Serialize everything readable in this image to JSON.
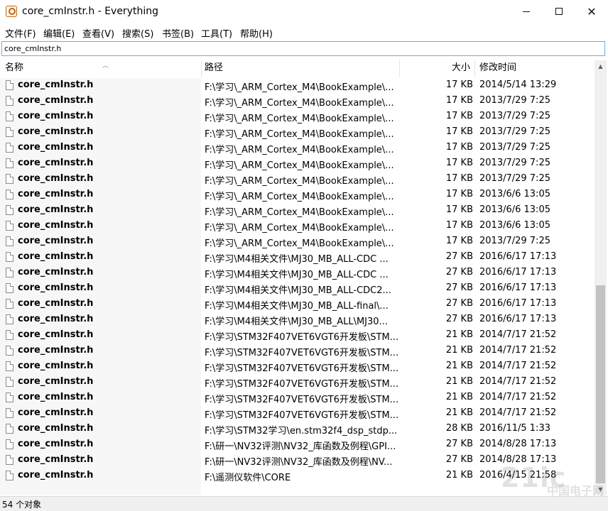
{
  "window": {
    "title": "core_cmInstr.h - Everything",
    "icon": "everything-app-icon"
  },
  "menu": [
    "文件(F)",
    "编辑(E)",
    "查看(V)",
    "搜索(S)",
    "书签(B)",
    "工具(T)",
    "帮助(H)"
  ],
  "search": {
    "value": "core_cmInstr.h"
  },
  "columns": {
    "name": "名称",
    "path": "路径",
    "size": "大小",
    "modified": "修改时间"
  },
  "rows": [
    {
      "name": "core_cmInstr.h",
      "path": "F:\\学习\\_ARM_Cortex_M4\\BookExample\\...",
      "size": "17 KB",
      "modified": "2014/5/14 13:29"
    },
    {
      "name": "core_cmInstr.h",
      "path": "F:\\学习\\_ARM_Cortex_M4\\BookExample\\...",
      "size": "17 KB",
      "modified": "2013/7/29 7:25"
    },
    {
      "name": "core_cmInstr.h",
      "path": "F:\\学习\\_ARM_Cortex_M4\\BookExample\\...",
      "size": "17 KB",
      "modified": "2013/7/29 7:25"
    },
    {
      "name": "core_cmInstr.h",
      "path": "F:\\学习\\_ARM_Cortex_M4\\BookExample\\...",
      "size": "17 KB",
      "modified": "2013/7/29 7:25"
    },
    {
      "name": "core_cmInstr.h",
      "path": "F:\\学习\\_ARM_Cortex_M4\\BookExample\\...",
      "size": "17 KB",
      "modified": "2013/7/29 7:25"
    },
    {
      "name": "core_cmInstr.h",
      "path": "F:\\学习\\_ARM_Cortex_M4\\BookExample\\...",
      "size": "17 KB",
      "modified": "2013/7/29 7:25"
    },
    {
      "name": "core_cmInstr.h",
      "path": "F:\\学习\\_ARM_Cortex_M4\\BookExample\\...",
      "size": "17 KB",
      "modified": "2013/7/29 7:25"
    },
    {
      "name": "core_cmInstr.h",
      "path": "F:\\学习\\_ARM_Cortex_M4\\BookExample\\...",
      "size": "17 KB",
      "modified": "2013/6/6 13:05"
    },
    {
      "name": "core_cmInstr.h",
      "path": "F:\\学习\\_ARM_Cortex_M4\\BookExample\\...",
      "size": "17 KB",
      "modified": "2013/6/6 13:05"
    },
    {
      "name": "core_cmInstr.h",
      "path": "F:\\学习\\_ARM_Cortex_M4\\BookExample\\...",
      "size": "17 KB",
      "modified": "2013/6/6 13:05"
    },
    {
      "name": "core_cmInstr.h",
      "path": "F:\\学习\\_ARM_Cortex_M4\\BookExample\\...",
      "size": "17 KB",
      "modified": "2013/7/29 7:25"
    },
    {
      "name": "core_cmInstr.h",
      "path": "F:\\学习\\M4相关文件\\MJ30_MB_ALL-CDC ...",
      "size": "27 KB",
      "modified": "2016/6/17 17:13"
    },
    {
      "name": "core_cmInstr.h",
      "path": "F:\\学习\\M4相关文件\\MJ30_MB_ALL-CDC ...",
      "size": "27 KB",
      "modified": "2016/6/17 17:13"
    },
    {
      "name": "core_cmInstr.h",
      "path": "F:\\学习\\M4相关文件\\MJ30_MB_ALL-CDC2...",
      "size": "27 KB",
      "modified": "2016/6/17 17:13"
    },
    {
      "name": "core_cmInstr.h",
      "path": "F:\\学习\\M4相关文件\\MJ30_MB_ALL-final\\...",
      "size": "27 KB",
      "modified": "2016/6/17 17:13"
    },
    {
      "name": "core_cmInstr.h",
      "path": "F:\\学习\\M4相关文件\\MJ30_MB_ALL\\MJ30...",
      "size": "27 KB",
      "modified": "2016/6/17 17:13"
    },
    {
      "name": "core_cmInstr.h",
      "path": "F:\\学习\\STM32F407VET6VGT6开发板\\STM...",
      "size": "21 KB",
      "modified": "2014/7/17 21:52"
    },
    {
      "name": "core_cmInstr.h",
      "path": "F:\\学习\\STM32F407VET6VGT6开发板\\STM...",
      "size": "21 KB",
      "modified": "2014/7/17 21:52"
    },
    {
      "name": "core_cmInstr.h",
      "path": "F:\\学习\\STM32F407VET6VGT6开发板\\STM...",
      "size": "21 KB",
      "modified": "2014/7/17 21:52"
    },
    {
      "name": "core_cmInstr.h",
      "path": "F:\\学习\\STM32F407VET6VGT6开发板\\STM...",
      "size": "21 KB",
      "modified": "2014/7/17 21:52"
    },
    {
      "name": "core_cmInstr.h",
      "path": "F:\\学习\\STM32F407VET6VGT6开发板\\STM...",
      "size": "21 KB",
      "modified": "2014/7/17 21:52"
    },
    {
      "name": "core_cmInstr.h",
      "path": "F:\\学习\\STM32F407VET6VGT6开发板\\STM...",
      "size": "21 KB",
      "modified": "2014/7/17 21:52"
    },
    {
      "name": "core_cmInstr.h",
      "path": "F:\\学习\\STM32学习\\en.stm32f4_dsp_stdp...",
      "size": "28 KB",
      "modified": "2016/11/5 1:33"
    },
    {
      "name": "core_cmInstr.h",
      "path": "F:\\研一\\NV32评测\\NV32_库函数及例程\\GPI...",
      "size": "27 KB",
      "modified": "2014/8/28 17:13"
    },
    {
      "name": "core_cmInstr.h",
      "path": "F:\\研一\\NV32评测\\NV32_库函数及例程\\NV...",
      "size": "27 KB",
      "modified": "2014/8/28 17:13"
    },
    {
      "name": "core_cmInstr.h",
      "path": "F:\\遥测仪软件\\CORE",
      "size": "21 KB",
      "modified": "2016/4/15 21:58"
    }
  ],
  "status": {
    "text": "54 个对象"
  },
  "scrollbar": {
    "position_fraction": 0.52,
    "visible_fraction": 0.48
  },
  "colors": {
    "accent": "#7aa7d6",
    "name_column_bg": "#f7f7f7",
    "thumb": "#c2c2c2"
  },
  "watermark": {
    "main": "21ic",
    "sub": "中国电子网"
  }
}
